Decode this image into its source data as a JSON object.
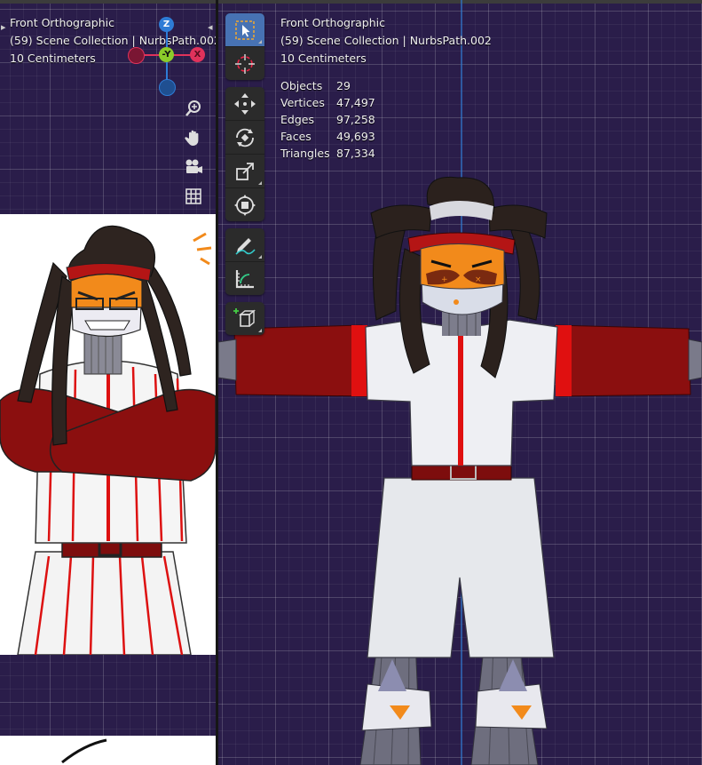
{
  "left_viewport": {
    "view_name": "Front Orthographic",
    "collection": "(59) Scene Collection | NurbsPath.002",
    "scale": "10 Centimeters",
    "gizmo": {
      "z": "Z",
      "y": "-Y",
      "x": "X"
    }
  },
  "right_viewport": {
    "view_name": "Front Orthographic",
    "collection": "(59) Scene Collection | NurbsPath.002",
    "scale": "10 Centimeters",
    "stats": [
      {
        "label": "Objects",
        "value": "29"
      },
      {
        "label": "Vertices",
        "value": "47,497"
      },
      {
        "label": "Edges",
        "value": "97,258"
      },
      {
        "label": "Faces",
        "value": "49,693"
      },
      {
        "label": "Triangles",
        "value": "87,334"
      }
    ]
  },
  "toolbar": {
    "tools": [
      "select-box",
      "cursor",
      "move",
      "rotate",
      "scale",
      "transform",
      "annotate",
      "measure",
      "add-cube"
    ],
    "active": "select-box"
  },
  "nav_icons": [
    "zoom-icon",
    "pan-hand-icon",
    "camera-icon",
    "grid-icon"
  ],
  "colors": {
    "viewport_bg": "#2a1d4a",
    "grid": "#4a3d6a",
    "active_tool": "#4772b3",
    "axis_x": "#e0325b",
    "axis_y": "#8bcb2a",
    "axis_z": "#2e7cd6",
    "jersey_red": "#8b0f0f",
    "accent_red": "#e01010",
    "mask_orange": "#f28a1b"
  }
}
